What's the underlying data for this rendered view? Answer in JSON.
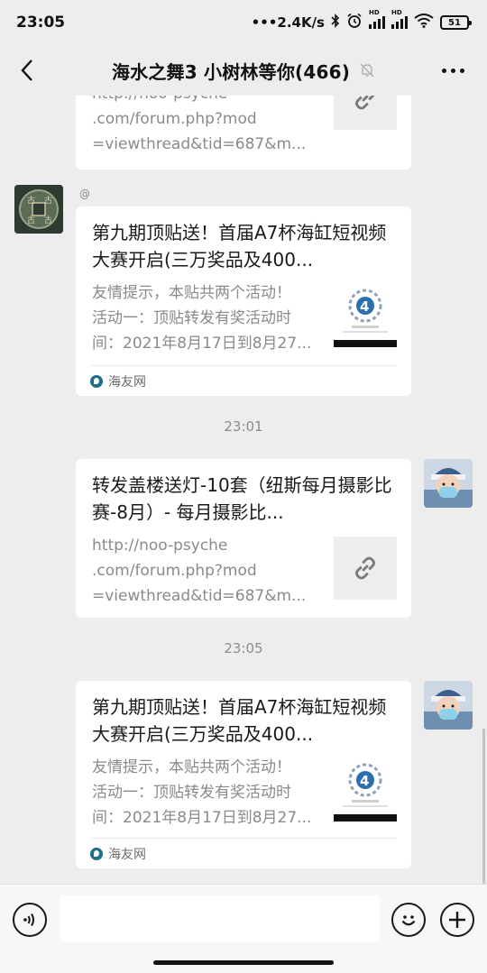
{
  "status": {
    "time": "23:05",
    "net_speed": "•••2.4K/s",
    "battery": "51"
  },
  "header": {
    "title": "海水之舞3 小树林等你(466)"
  },
  "messages": [
    {
      "url_lines": [
        "http://noo-psyche",
        ".com/forum.php?mod",
        "=viewthread&tid=687&m..."
      ]
    },
    {
      "sender": "@",
      "title": "第九期顶贴送！首届A7杯海缸短视频大赛开启(三万奖品及400...",
      "desc_lines": [
        "友情提示，本贴共两个活动！",
        "活动一：顶贴转发有奖活动时",
        "间：2021年8月17日到8月27..."
      ],
      "source": "海友网"
    },
    {
      "time": "23:01",
      "title": "转发盖楼送灯-10套（纽斯每月摄影比赛-8月）- 每月摄影比...",
      "url_lines": [
        "http://noo-psyche",
        ".com/forum.php?mod",
        "=viewthread&tid=687&m..."
      ]
    },
    {
      "time": "23:05",
      "title": "第九期顶贴送！首届A7杯海缸短视频大赛开启(三万奖品及400...",
      "desc_lines": [
        "友情提示，本贴共两个活动！",
        "活动一：顶贴转发有奖活动时",
        "间：2021年8月17日到8月27..."
      ],
      "source": "海友网"
    }
  ],
  "input": {
    "placeholder": ""
  },
  "colors": {
    "background": "#ededed",
    "card": "#ffffff",
    "muted": "#8a8a8a"
  }
}
